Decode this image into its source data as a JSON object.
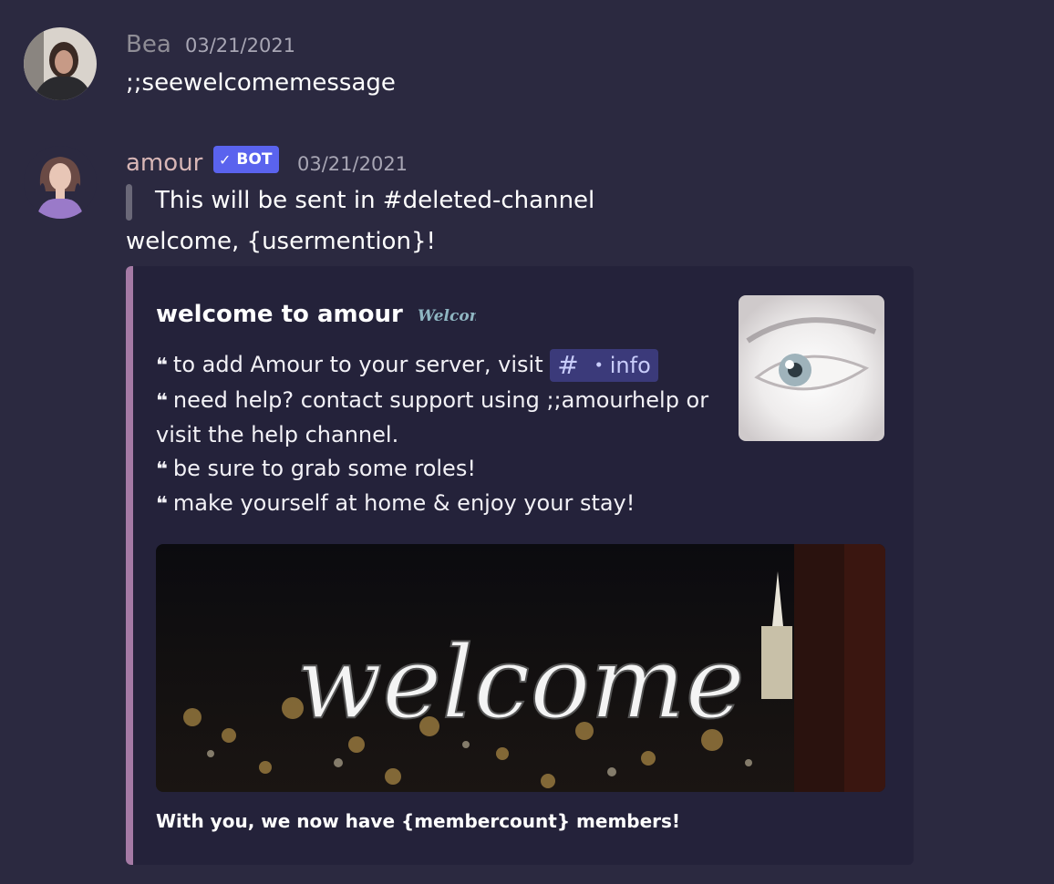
{
  "messages": [
    {
      "username": "Bea",
      "timestamp": "03/21/2021",
      "content": ";;seewelcomemessage"
    },
    {
      "username": "amour",
      "bot_badge": "BOT",
      "timestamp": "03/21/2021",
      "quote": "This will be sent in #deleted-channel",
      "content": "welcome, {usermention}!",
      "embed": {
        "accent_color": "#a57aa5",
        "title": "welcome to amour",
        "title_sticker_text": "Welcome",
        "lines": [
          "to add Amour to your server, visit",
          "need help? contact support using ;;amourhelp or",
          "visit the help channel.",
          "be sure to grab some roles!",
          "make yourself at home & enjoy your stay!"
        ],
        "channel_mention": "・info",
        "banner_text": "welcome",
        "footer": "With you, we now have {membercount} members!"
      }
    }
  ],
  "colors": {
    "background": "#2b2940",
    "bot_badge": "#5a63ee",
    "mention_bg": "#3b3a7a",
    "username_bea": "#8f8d96",
    "username_amour": "#d8b6b6"
  },
  "icons": {
    "bot_check": "checkmark-icon",
    "quote_glyph": "quote-icon",
    "channel": "hash-icon"
  }
}
